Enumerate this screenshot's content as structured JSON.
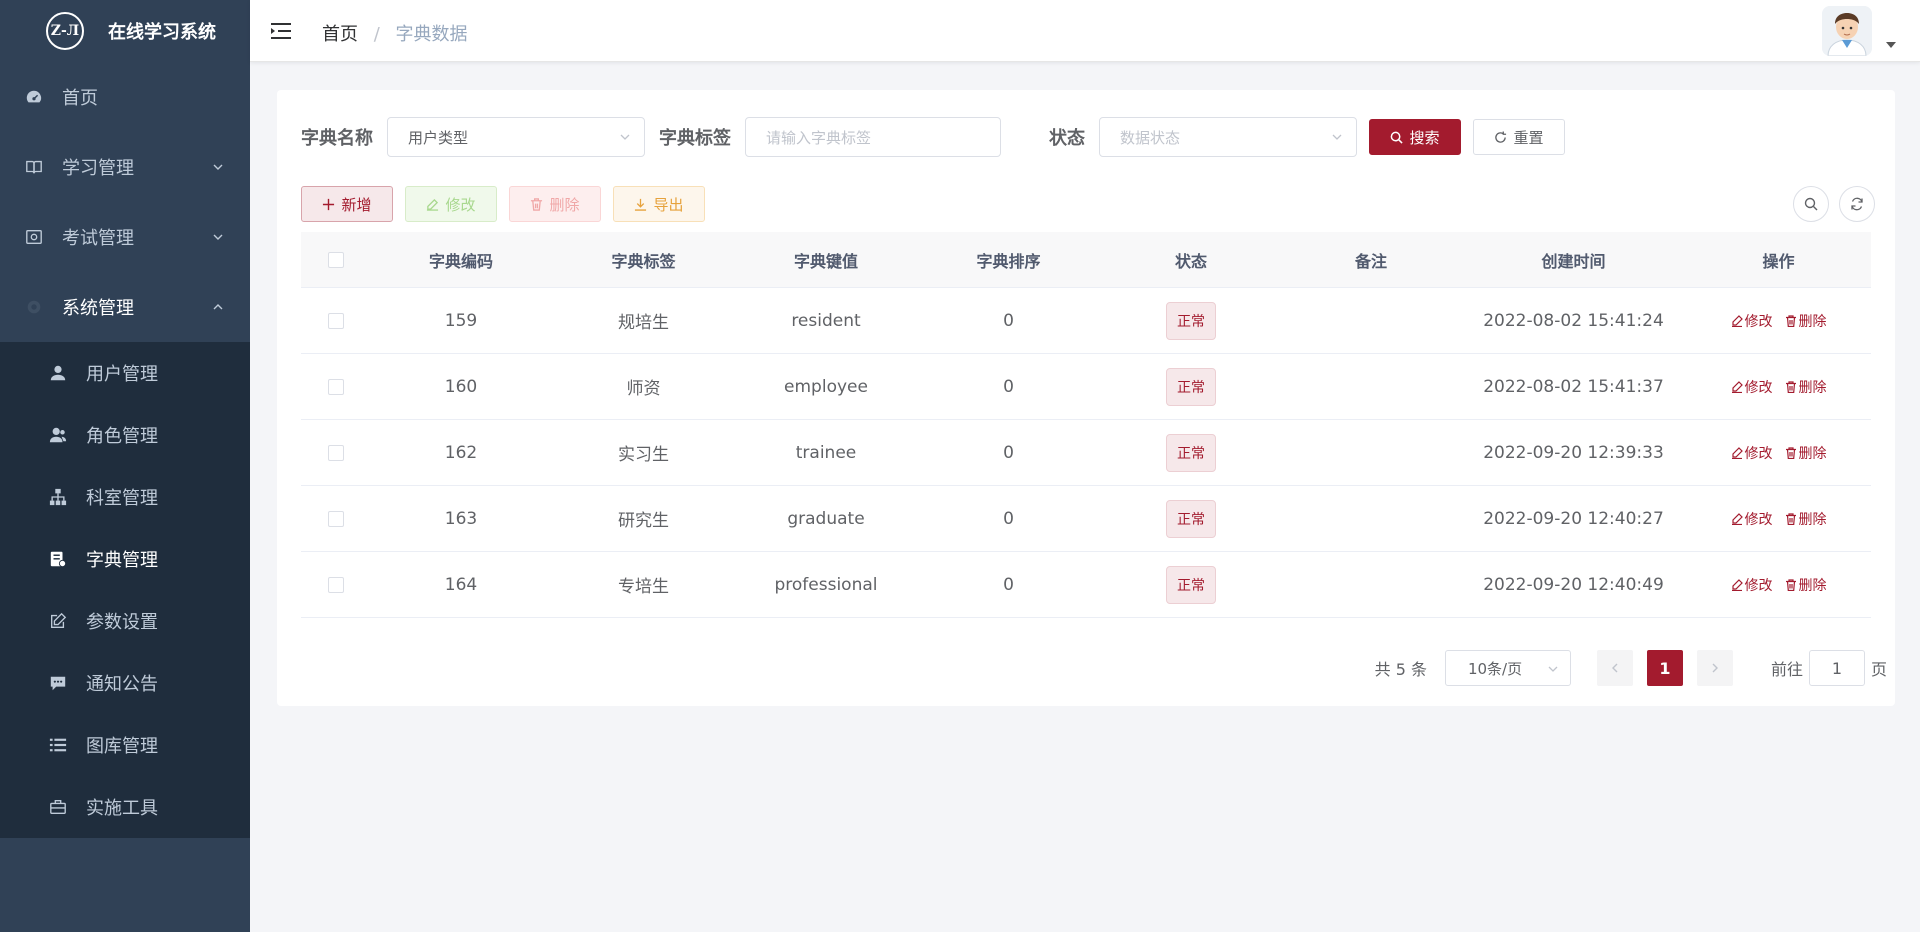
{
  "app": {
    "logo_text": "Z-Л",
    "title": "在线学习系统"
  },
  "sidebar": {
    "items": [
      {
        "label": "首页",
        "icon": "dashboard-icon"
      },
      {
        "label": "学习管理",
        "icon": "book-icon",
        "expandable": true
      },
      {
        "label": "考试管理",
        "icon": "exam-icon",
        "expandable": true
      },
      {
        "label": "系统管理",
        "icon": "system-icon",
        "expandable": true,
        "open": true
      }
    ],
    "sub_items": [
      {
        "label": "用户管理",
        "icon": "user-icon"
      },
      {
        "label": "角色管理",
        "icon": "role-icon"
      },
      {
        "label": "科室管理",
        "icon": "tree-icon"
      },
      {
        "label": "字典管理",
        "icon": "dict-icon",
        "active": true
      },
      {
        "label": "参数设置",
        "icon": "edit-icon"
      },
      {
        "label": "通知公告",
        "icon": "message-icon"
      },
      {
        "label": "图库管理",
        "icon": "list-icon"
      },
      {
        "label": "实施工具",
        "icon": "toolbox-icon"
      }
    ]
  },
  "header": {
    "breadcrumb_home": "首页",
    "breadcrumb_sep": "/",
    "breadcrumb_current": "字典数据"
  },
  "search": {
    "dict_name_label": "字典名称",
    "dict_name_value": "用户类型",
    "dict_label_label": "字典标签",
    "dict_label_placeholder": "请输入字典标签",
    "status_label": "状态",
    "status_placeholder": "数据状态",
    "search_button": "搜索",
    "reset_button": "重置"
  },
  "toolbar": {
    "add": "新增",
    "edit": "修改",
    "delete": "删除",
    "export": "导出"
  },
  "table": {
    "headers": [
      "字典编码",
      "字典标签",
      "字典键值",
      "字典排序",
      "状态",
      "备注",
      "创建时间",
      "操作"
    ],
    "rows": [
      {
        "code": "159",
        "label": "规培生",
        "value": "resident",
        "sort": "0",
        "status": "正常",
        "remark": "",
        "created": "2022-08-02 15:41:24"
      },
      {
        "code": "160",
        "label": "师资",
        "value": "employee",
        "sort": "0",
        "status": "正常",
        "remark": "",
        "created": "2022-08-02 15:41:37"
      },
      {
        "code": "162",
        "label": "实习生",
        "value": "trainee",
        "sort": "0",
        "status": "正常",
        "remark": "",
        "created": "2022-09-20 12:39:33"
      },
      {
        "code": "163",
        "label": "研究生",
        "value": "graduate",
        "sort": "0",
        "status": "正常",
        "remark": "",
        "created": "2022-09-20 12:40:27"
      },
      {
        "code": "164",
        "label": "专培生",
        "value": "professional",
        "sort": "0",
        "status": "正常",
        "remark": "",
        "created": "2022-09-20 12:40:49"
      }
    ],
    "op_edit": "修改",
    "op_delete": "删除"
  },
  "pagination": {
    "total": "共 5 条",
    "page_size": "10条/页",
    "current_page": "1",
    "goto_prefix": "前往",
    "goto_value": "1",
    "goto_suffix": "页"
  },
  "colors": {
    "brand": "#a31b2e",
    "sidebar_bg": "#304156",
    "submenu_bg": "#1f2d3d"
  }
}
